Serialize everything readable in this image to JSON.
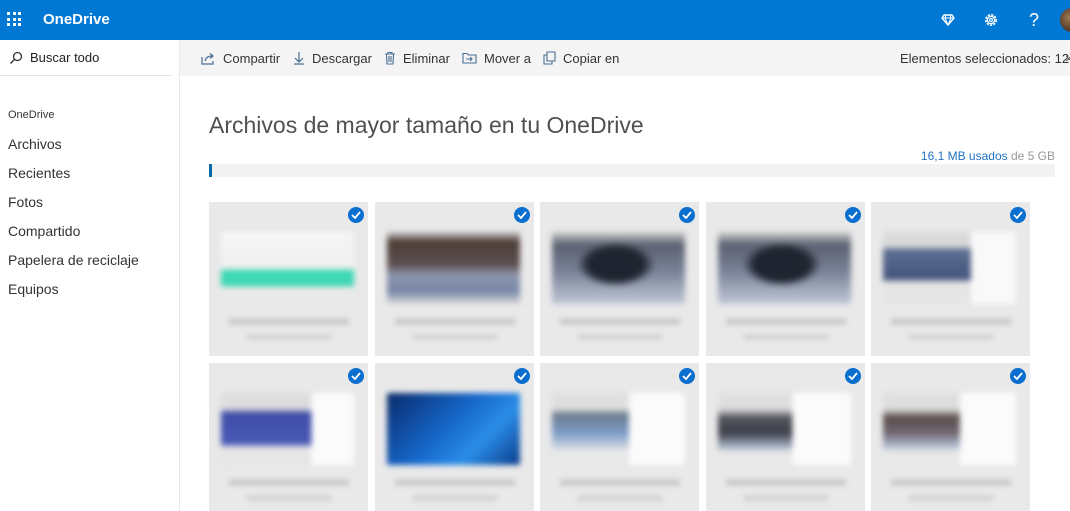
{
  "app": {
    "name": "OneDrive",
    "accent": "#0078d4",
    "icons": [
      "waffle-icon",
      "diamond-icon",
      "gear-icon",
      "help-icon"
    ],
    "help_glyph": "?"
  },
  "sidebar": {
    "search_label": "Buscar todo",
    "section_label": "OneDrive",
    "items": [
      {
        "label": "Archivos"
      },
      {
        "label": "Recientes"
      },
      {
        "label": "Fotos"
      },
      {
        "label": "Compartido"
      },
      {
        "label": "Papelera de reciclaje"
      },
      {
        "label": "Equipos"
      }
    ]
  },
  "commandbar": {
    "share": "Compartir",
    "download": "Descargar",
    "delete": "Eliminar",
    "move": "Mover a",
    "copy": "Copiar en",
    "selected_label": "Elementos seleccionados: 12",
    "close_glyph": "×"
  },
  "main": {
    "title": "Archivos de mayor tamaño en tu OneDrive",
    "usage_used": "16,1 MB usados",
    "usage_rest": " de 5 GB",
    "usage_fraction": 0.003,
    "usage_color": "#0a6aa8",
    "tiles_selected": 10,
    "check_color": "#0b6fcf"
  }
}
